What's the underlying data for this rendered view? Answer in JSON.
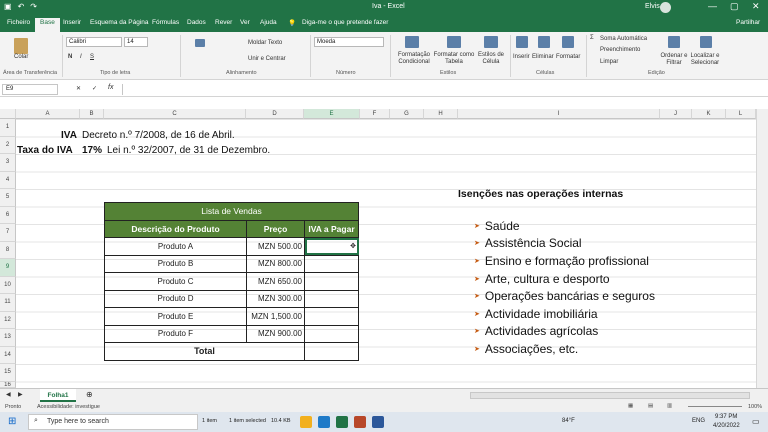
{
  "window": {
    "title": "Iva  -  Excel",
    "user": "Elvis",
    "minimize": "—",
    "restore": "▢",
    "close": "✕"
  },
  "tabs": [
    "Ficheiro",
    "Base",
    "Inserir",
    "Esquema da Página",
    "Fórmulas",
    "Dados",
    "Rever",
    "Ver",
    "Ajuda"
  ],
  "tellme": "Diga-me o que pretende fazer",
  "share": "Partilhar",
  "ribbon": {
    "paste": "Colar",
    "clipboard_group": "Área de Transferência",
    "font_name": "Calibri",
    "font_size": "14",
    "font_group": "Tipo de letra",
    "wrap": "Moldar Texto",
    "merge": "Unir e Centrar",
    "align_group": "Alinhamento",
    "number_format": "Moeda",
    "number_group": "Número",
    "cond_format": "Formatação Condicional",
    "format_table": "Formatar como Tabela",
    "cell_styles": "Estilos de Célula",
    "styles_group": "Estilos",
    "insert": "Inserir",
    "delete": "Eliminar",
    "format": "Formatar",
    "cells_group": "Células",
    "autosum": "Soma Automática",
    "fill": "Preenchimento",
    "clear": "Limpar",
    "sort": "Ordenar e Filtrar",
    "find": "Localizar e Selecionar",
    "edit_group": "Edição"
  },
  "formula_bar": {
    "name_box": "E9",
    "fx": "fx",
    "content": ""
  },
  "columns": [
    "A",
    "B",
    "C",
    "D",
    "E",
    "F",
    "G",
    "H",
    "I",
    "J",
    "K",
    "L"
  ],
  "rows": [
    "1",
    "2",
    "3",
    "4",
    "5",
    "6",
    "7",
    "8",
    "9",
    "10",
    "11",
    "12",
    "13",
    "14",
    "15",
    "16"
  ],
  "sheet": {
    "iva_label": "IVA",
    "iva_decree": "Decreto n.º 7/2008, de 16 de Abril.",
    "rate_label": "Taxa do IVA",
    "rate_value": "17%",
    "rate_law": "Lei n.º 32/2007, de 31 de Dezembro.",
    "table_title": "Lista de Vendas",
    "col_desc": "Descrição do Produto",
    "col_price": "Preço",
    "col_iva": "IVA a Pagar",
    "products": [
      {
        "name": "Produto A",
        "price": "MZN 500.00"
      },
      {
        "name": "Produto B",
        "price": "MZN 800.00"
      },
      {
        "name": "Produto C",
        "price": "MZN 650.00"
      },
      {
        "name": "Produto D",
        "price": "MZN 300.00"
      },
      {
        "name": "Produto E",
        "price": "MZN 1,500.00"
      },
      {
        "name": "Produto F",
        "price": "MZN 900.00"
      }
    ],
    "total": "Total",
    "exemptions_title": "Isenções nas operações internas",
    "exemptions": [
      "Saúde",
      "Assistência Social",
      "Ensino e formação profissional",
      "Arte, cultura e desporto",
      "Operações bancárias e seguros",
      "Actividade imobiliária",
      "Actividades agrícolas",
      "Associações, etc."
    ]
  },
  "sheet_tab": "Folha1",
  "status": {
    "ready": "Pronto",
    "accessibility": "Acessibilidade: investigue",
    "zoom": "100%"
  },
  "taskbar": {
    "search": "Type here to search",
    "status_left": "1 item",
    "status_sel": "1 item selected",
    "status_size": "10.4 KB",
    "temp": "84°F",
    "lang": "ENG",
    "time": "9:37 PM",
    "date": "4/20/2022"
  },
  "colors": {
    "excel_green": "#217346",
    "table_header": "#548235",
    "bullet": "#c55a11"
  }
}
